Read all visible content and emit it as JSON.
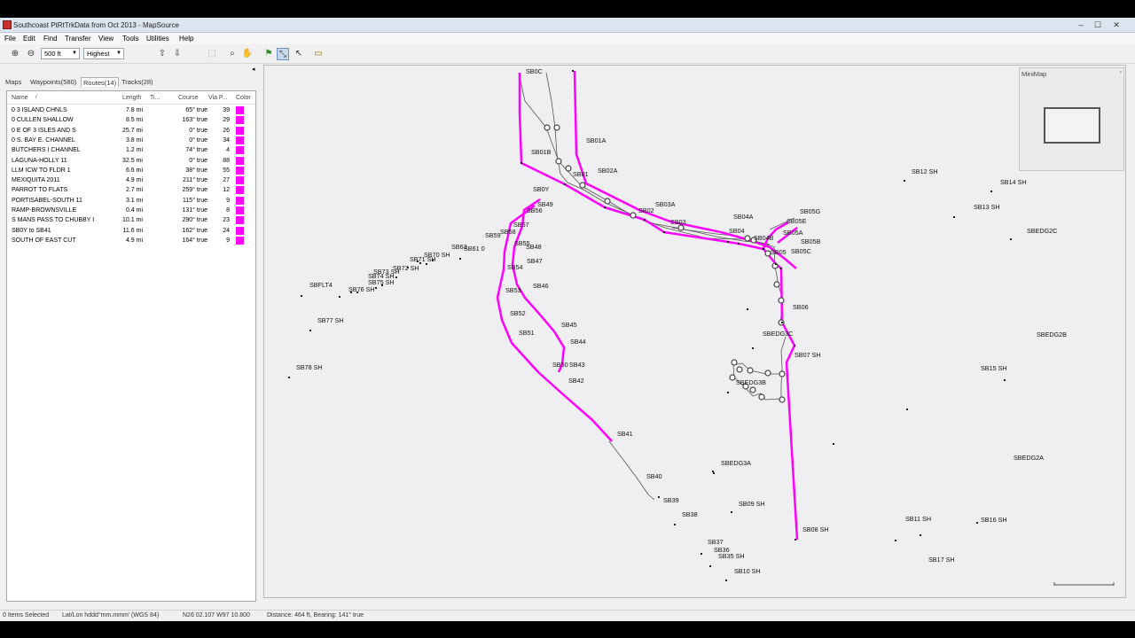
{
  "window": {
    "title": "Southcoast PtRtTrkData from Oct 2013 - MapSource",
    "minimize": "–",
    "maximize": "☐",
    "close": "✕"
  },
  "menu": [
    "File",
    "Edit",
    "Find",
    "Transfer",
    "View",
    "Tools",
    "Utilities",
    "Help"
  ],
  "toolbar": {
    "zoom_in_icon": "zoom-in-icon",
    "zoom_out_icon": "zoom-out-icon",
    "scale_value": "500 ft",
    "detail_value": "Highest"
  },
  "tabs": [
    {
      "label": "Maps"
    },
    {
      "label": "Waypoints(580)"
    },
    {
      "label": "Routes(14)"
    },
    {
      "label": "Tracks(28)"
    }
  ],
  "columns": {
    "name": "Name",
    "length": "Length",
    "time": "Ti...",
    "course": "Course",
    "via": "Via P...",
    "color": "Color"
  },
  "routes": [
    {
      "name": "0 3 ISLAND CHNLS",
      "length": "7.8 mi",
      "course": "65° true",
      "via": "39",
      "color": "#ff00ff"
    },
    {
      "name": "0 CULLEN SHALLOW",
      "length": "8.5 mi",
      "course": "163° true",
      "via": "29",
      "color": "#ff00ff"
    },
    {
      "name": "0 E OF 3 ISLES AND S",
      "length": "25.7 mi",
      "course": "0° true",
      "via": "26",
      "color": "#ff00ff"
    },
    {
      "name": "0 S. BAY E. CHANNEL",
      "length": "3.8 mi",
      "course": "0° true",
      "via": "34",
      "color": "#ff00ff"
    },
    {
      "name": "BUTCHERS I CHANNEL",
      "length": "1.2 mi",
      "course": "74° true",
      "via": "4",
      "color": "#ff00ff"
    },
    {
      "name": "LAGUNA-HOLLY 11",
      "length": "32.5 mi",
      "course": "0° true",
      "via": "88",
      "color": "#ff00ff"
    },
    {
      "name": "LLM ICW TO FLDR 1",
      "length": "6.6 mi",
      "course": "38° true",
      "via": "55",
      "color": "#ff00ff"
    },
    {
      "name": "MEXIQUITA 2011",
      "length": "4.9 mi",
      "course": "211° true",
      "via": "27",
      "color": "#ff00ff"
    },
    {
      "name": "PARROT TO FLATS",
      "length": "2.7 mi",
      "course": "259° true",
      "via": "12",
      "color": "#ff00ff"
    },
    {
      "name": "PORTISABEL-SOUTH 11",
      "length": "3.1 mi",
      "course": "115° true",
      "via": "9",
      "color": "#ff00ff"
    },
    {
      "name": "RAMP-BROWNSVILLE",
      "length": "0.4 mi",
      "course": "131° true",
      "via": "8",
      "color": "#ff00ff"
    },
    {
      "name": "S MANS PASS TO CHUBBY I",
      "length": "10.1 mi",
      "course": "290° true",
      "via": "23",
      "color": "#ff00ff"
    },
    {
      "name": "SB0Y to SB41",
      "length": "11.6 mi",
      "course": "162° true",
      "via": "24",
      "color": "#ff00ff"
    },
    {
      "name": "SOUTH OF EAST CUT",
      "length": "4.9 mi",
      "course": "164° true",
      "via": "9",
      "color": "#ff00ff"
    }
  ],
  "minimap": {
    "title": "MiniMap"
  },
  "map": {
    "route_color": "#ff00ff",
    "track_color": "#555555",
    "waypoints": [
      {
        "label": "SB0C"
      },
      {
        "label": "SB01A"
      },
      {
        "label": "SB01B"
      },
      {
        "label": "SB02A"
      },
      {
        "label": "SB01"
      },
      {
        "label": "SB0Y"
      },
      {
        "label": "SB03A"
      },
      {
        "label": "SB02"
      },
      {
        "label": "SB03"
      },
      {
        "label": "SB04A"
      },
      {
        "label": "SB04"
      },
      {
        "label": "SB04B"
      },
      {
        "label": "SB05G"
      },
      {
        "label": "SB05E"
      },
      {
        "label": "SB05A"
      },
      {
        "label": "SB05B"
      },
      {
        "label": "SB05"
      },
      {
        "label": "SB05C"
      },
      {
        "label": "SB06"
      },
      {
        "label": "SBEDG3C"
      },
      {
        "label": "SB07 SH"
      },
      {
        "label": "SBEDG3B"
      },
      {
        "label": "SB49"
      },
      {
        "label": "SB56"
      },
      {
        "label": "SB57"
      },
      {
        "label": "SB59"
      },
      {
        "label": "SB58"
      },
      {
        "label": "SB55"
      },
      {
        "label": "SB48"
      },
      {
        "label": "SB47"
      },
      {
        "label": "SB54"
      },
      {
        "label": "SB46"
      },
      {
        "label": "SB53"
      },
      {
        "label": "SB52"
      },
      {
        "label": "SB45"
      },
      {
        "label": "SB51"
      },
      {
        "label": "SB44"
      },
      {
        "label": "SB50"
      },
      {
        "label": "SB43"
      },
      {
        "label": "SB42"
      },
      {
        "label": "SB41"
      },
      {
        "label": "SB40"
      },
      {
        "label": "SB39"
      },
      {
        "label": "SB38"
      },
      {
        "label": "SB37"
      },
      {
        "label": "SB36"
      },
      {
        "label": "SB35 SH"
      },
      {
        "label": "SB10 SH"
      },
      {
        "label": "SB09 SH"
      },
      {
        "label": "SBEDG3A"
      },
      {
        "label": "SB08 SH"
      },
      {
        "label": "SB11 SH"
      },
      {
        "label": "SB16 SH"
      },
      {
        "label": "SB17 SH"
      },
      {
        "label": "SBEDG2A"
      },
      {
        "label": "SB15 SH"
      },
      {
        "label": "SBEDG2B"
      },
      {
        "label": "SBEDG2C"
      },
      {
        "label": "SB12 SH"
      },
      {
        "label": "SB13 SH"
      },
      {
        "label": "SB14 SH"
      },
      {
        "label": "SBFLT4"
      },
      {
        "label": "SB77 SH"
      },
      {
        "label": "SB78 SH"
      },
      {
        "label": "SB76 SH"
      },
      {
        "label": "SB75 SH"
      },
      {
        "label": "SB74 SH"
      },
      {
        "label": "SB73 SH"
      },
      {
        "label": "SB72 SH"
      },
      {
        "label": "SB71 SH"
      },
      {
        "label": "SB70 SH"
      },
      {
        "label": "SB63"
      },
      {
        "label": "SB61 0"
      }
    ]
  },
  "statusbar": {
    "selected": "0 Items Selected",
    "format": "Lat/Lon hddd°mm.mmm' (WGS 84)",
    "position": "N26 02.107 W97 10.800",
    "distance": "Distance: 464 ft, Bearing: 141° true"
  }
}
